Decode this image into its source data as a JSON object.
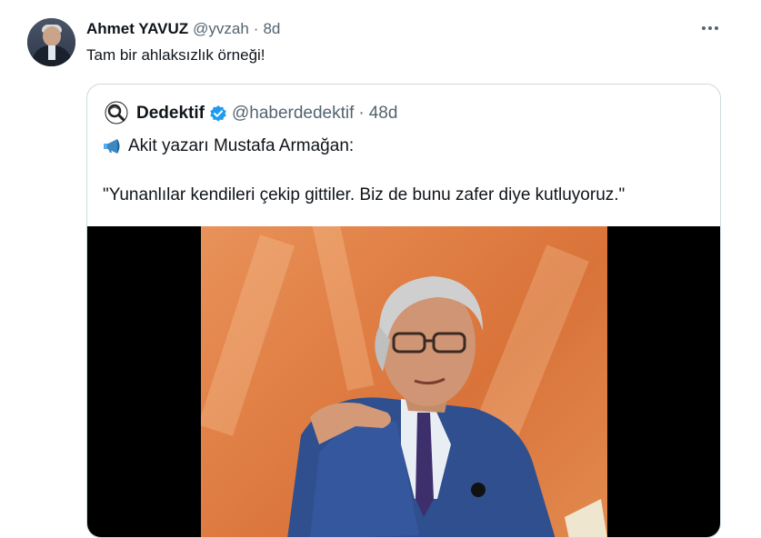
{
  "tweet": {
    "author_name": "Ahmet YAVUZ",
    "handle": "@yvzah",
    "separator": "·",
    "time": "8d",
    "text": "Tam bir ahlaksızlık örneği!",
    "more_icon": "more-horizontal-icon"
  },
  "quoted": {
    "author_name": "Dedektif",
    "handle": "@haberdedektif",
    "separator": "·",
    "time": "48d",
    "verified": true,
    "line1": "Akit yazarı Mustafa Armağan:",
    "line2": "\"Yunanlılar kendileri çekip gittiler. Biz de bunu zafer diye kutluyoruz.\"",
    "line1_icon": "megaphone-icon"
  },
  "colors": {
    "text": "#0f1419",
    "muted": "#536471",
    "border": "#cfd9de",
    "verified": "#1d9bf0"
  }
}
